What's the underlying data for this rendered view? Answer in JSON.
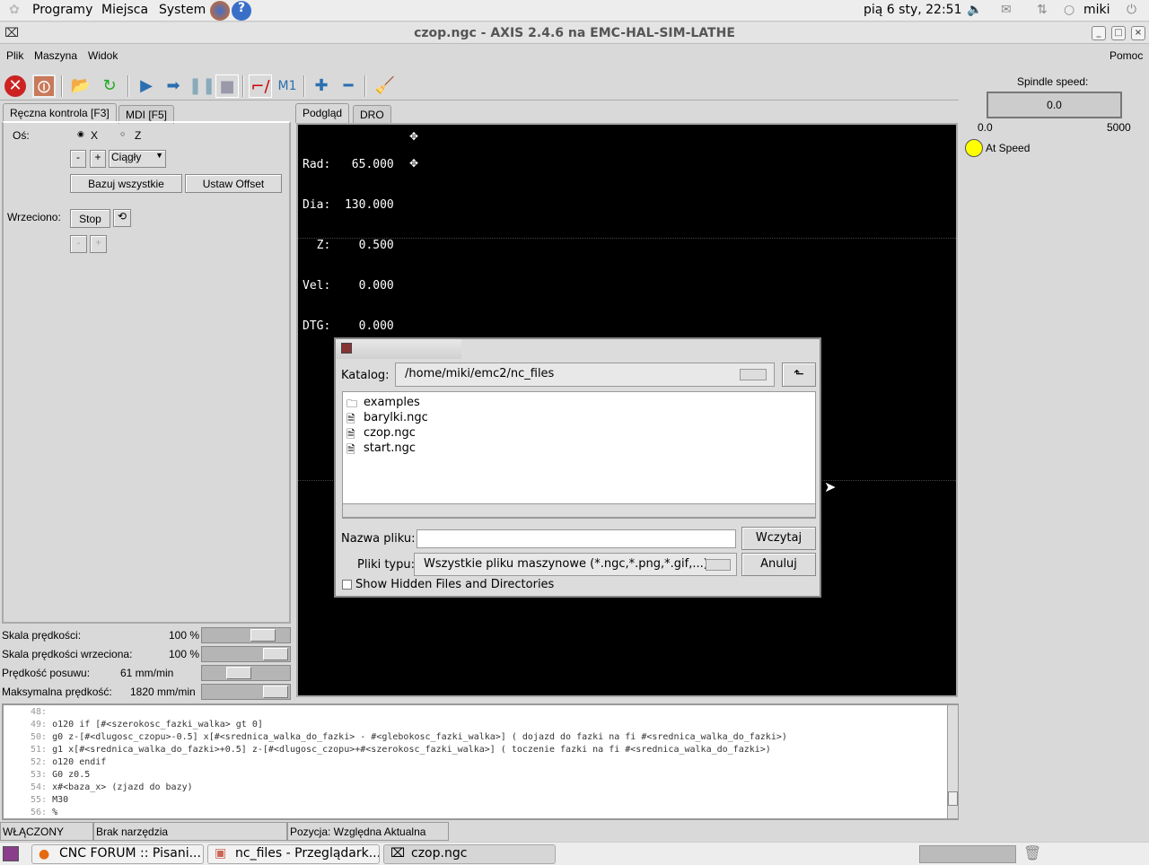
{
  "top_panel": {
    "menus": [
      "Programy",
      "Miejsca",
      "System"
    ],
    "datetime": "pią  6 sty, 22:51",
    "user": "miki"
  },
  "window": {
    "title": "czop.ngc - AXIS 2.4.6 na EMC-HAL-SIM-LATHE"
  },
  "menubar": {
    "items": [
      "Plik",
      "Maszyna",
      "Widok"
    ],
    "help": "Pomoc"
  },
  "tabs_left": [
    "Ręczna kontrola [F3]",
    "MDI [F5]"
  ],
  "tabs_right": [
    "Podgląd",
    "DRO"
  ],
  "manual": {
    "axis_label": "Oś:",
    "axis_x": "X",
    "axis_z": "Z",
    "axis_selected": "X",
    "minus": "-",
    "plus": "+",
    "jog_mode": "Ciągły",
    "home_all": "Bazuj wszystkie",
    "set_offset": "Ustaw Offset",
    "spindle_label": "Wrzeciono:",
    "spindle_stop": "Stop"
  },
  "sliders": [
    {
      "label": "Skala prędkości:",
      "value": "100 %",
      "fraction": 0.8
    },
    {
      "label": "Skala prędkości wrzeciona:",
      "value": "100 %",
      "fraction": 1.0
    },
    {
      "label": "Prędkość posuwu:",
      "value": "61 mm/min",
      "fraction": 0.4
    },
    {
      "label": "Maksymalna prędkość:",
      "value": "1820 mm/min",
      "fraction": 1.0
    }
  ],
  "dro": {
    "lines": [
      "Rad:   65.000",
      "Dia:  130.000",
      "  Z:    0.500",
      "Vel:    0.000",
      "DTG:    0.000"
    ]
  },
  "spindle": {
    "label": "Spindle speed:",
    "value": "0.0",
    "min": "0.0",
    "max": "5000",
    "at_speed": "At Speed",
    "indicator_color": "#ffff00"
  },
  "gcode": [
    {
      "n": "48:",
      "t": ""
    },
    {
      "n": "49:",
      "t": "o120 if [#<szerokosc_fazki_walka> gt 0]"
    },
    {
      "n": "50:",
      "t": "g0 z-[#<dlugosc_czopu>-0.5] x[#<srednica_walka_do_fazki> - #<glebokosc_fazki_walka>] ( dojazd do fazki na fi #<srednica_walka_do_fazki>)"
    },
    {
      "n": "51:",
      "t": "g1 x[#<srednica_walka_do_fazki>+0.5] z-[#<dlugosc_czopu>+#<szerokosc_fazki_walka>] ( toczenie fazki na fi #<srednica_walka_do_fazki>)"
    },
    {
      "n": "52:",
      "t": "o120 endif"
    },
    {
      "n": "53:",
      "t": "G0 z0.5"
    },
    {
      "n": "54:",
      "t": "x#<baza_x> (zjazd do bazy)"
    },
    {
      "n": "55:",
      "t": "M30"
    },
    {
      "n": "56:",
      "t": "%"
    }
  ],
  "status": {
    "state": "WŁĄCZONY",
    "tool": "Brak narzędzia",
    "position": "Pozycja: Względna Aktualna"
  },
  "dialog": {
    "dir_label": "Katalog:",
    "dir_value": "/home/miki/emc2/nc_files",
    "files": [
      {
        "name": "examples",
        "type": "folder"
      },
      {
        "name": "barylki.ngc",
        "type": "file"
      },
      {
        "name": "czop.ngc",
        "type": "file"
      },
      {
        "name": "start.ngc",
        "type": "file"
      }
    ],
    "filename_label": "Nazwa pliku:",
    "filename_value": "",
    "open": "Wczytaj",
    "filetype_label": "Pliki typu:",
    "filetype_value": "Wszystkie pliku maszynowe (*.ngc,*.png,*.gif,...)",
    "cancel": "Anuluj",
    "show_hidden": "Show Hidden Files and Directories"
  },
  "taskbar": [
    "CNC FORUM :: Pisani...",
    "nc_files - Przeglądark...",
    "czop.ngc"
  ]
}
